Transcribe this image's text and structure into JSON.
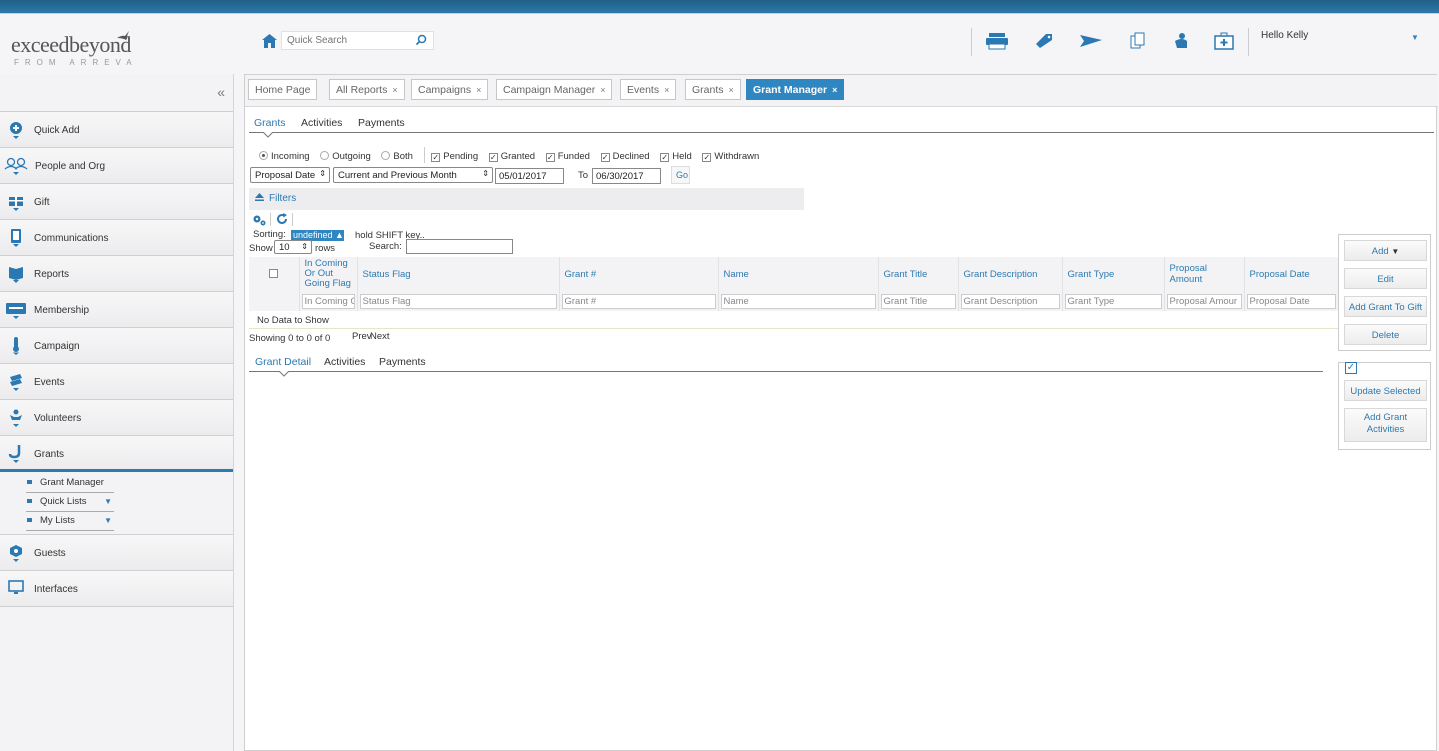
{
  "header": {
    "logo_main": "exceedbeyond",
    "logo_sub": "FROM ARREVA",
    "search_placeholder": "Quick Search",
    "greeting": "Hello Kelly"
  },
  "sidebar": {
    "collapse_glyph": "«",
    "items": [
      {
        "label": "Quick Add",
        "icon": "plus-circle-icon"
      },
      {
        "label": "People and Org",
        "icon": "people-icon"
      },
      {
        "label": "Gift",
        "icon": "gift-icon"
      },
      {
        "label": "Communications",
        "icon": "phone-icon"
      },
      {
        "label": "Reports",
        "icon": "reports-icon"
      },
      {
        "label": "Membership",
        "icon": "membership-card-icon"
      },
      {
        "label": "Campaign",
        "icon": "thermometer-icon"
      },
      {
        "label": "Events",
        "icon": "events-icon"
      },
      {
        "label": "Volunteers",
        "icon": "volunteer-icon"
      },
      {
        "label": "Grants",
        "icon": "grants-icon"
      },
      {
        "label": "Guests",
        "icon": "guests-icon"
      },
      {
        "label": "Interfaces",
        "icon": "monitor-icon"
      }
    ],
    "grants_sub": [
      {
        "label": "Grant Manager"
      },
      {
        "label": "Quick Lists"
      },
      {
        "label": "My Lists"
      }
    ]
  },
  "page_tabs": [
    {
      "label": "Home Page",
      "closable": false
    },
    {
      "label": "All Reports",
      "closable": true
    },
    {
      "label": "Campaigns",
      "closable": true
    },
    {
      "label": "Campaign Manager",
      "closable": true
    },
    {
      "label": "Events",
      "closable": true
    },
    {
      "label": "Grants",
      "closable": true
    },
    {
      "label": "Grant Manager",
      "closable": true,
      "active": true
    }
  ],
  "tab_close_glyph": "×",
  "sub_tabs": [
    "Grants",
    "Activities",
    "Payments"
  ],
  "direction": {
    "options": [
      "Incoming",
      "Outgoing",
      "Both"
    ],
    "selected": "Incoming"
  },
  "status_flags": [
    "Pending",
    "Granted",
    "Funded",
    "Declined",
    "Held",
    "Withdrawn"
  ],
  "date_filter": {
    "field": "Proposal Date",
    "range": "Current and Previous Month",
    "from": "05/01/2017",
    "to_label": "To",
    "to": "06/30/2017",
    "go_label": "Go"
  },
  "filters_label": "Filters",
  "sorting": {
    "label": "Sorting:",
    "badge": "undefined ▲",
    "hint": "hold SHIFT key.."
  },
  "paging": {
    "show_label": "Show",
    "rows_value": "10",
    "rows_label": "rows",
    "search_label": "Search:"
  },
  "grid": {
    "columns": [
      "In Coming Or Out Going Flag",
      "Status Flag",
      "Grant #",
      "Name",
      "Grant Title",
      "Grant Description",
      "Grant Type",
      "Proposal Amount",
      "Proposal Date"
    ],
    "filter_placeholders": [
      "In Coming C",
      "Status Flag",
      "Grant #",
      "Name",
      "Grant Title",
      "Grant Description",
      "Grant Type",
      "Proposal Amour",
      "Proposal Date"
    ],
    "empty_text": "No Data to Show",
    "showing_text": "Showing 0 to 0 of 0",
    "prev_label": "Prev",
    "next_label": "Next"
  },
  "actions": {
    "add": "Add",
    "edit": "Edit",
    "add_grant_to_gift": "Add Grant To Gift",
    "delete": "Delete",
    "update_selected": "Update Selected",
    "add_grant_activities": "Add Grant Activities"
  },
  "detail_tabs": [
    "Grant Detail",
    "Activities",
    "Payments"
  ],
  "colors": {
    "accent": "#2d7ab0",
    "active_tab": "#2f86c0",
    "topbar": "#1f5f88"
  }
}
